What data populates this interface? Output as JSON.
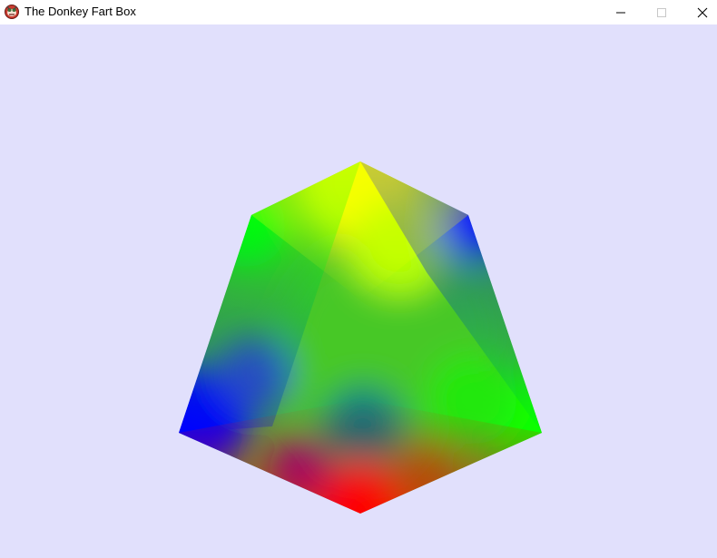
{
  "window": {
    "title": "The Donkey Fart Box",
    "background_color": "#E1E0FC",
    "icon": "app-logo-icon",
    "controls": {
      "minimize": "minimize-icon",
      "maximize": "maximize-icon",
      "close": "close-icon"
    }
  },
  "scene": {
    "object": "rgb-color-cube",
    "vertex_colors": {
      "top": "#FFFF00",
      "upper_left": "#00FF00",
      "upper_right": "#0000FF",
      "lower_left": "#0000FF",
      "lower_right": "#00FF00",
      "bottom": "#FF0000",
      "center": "#00FF00"
    }
  }
}
